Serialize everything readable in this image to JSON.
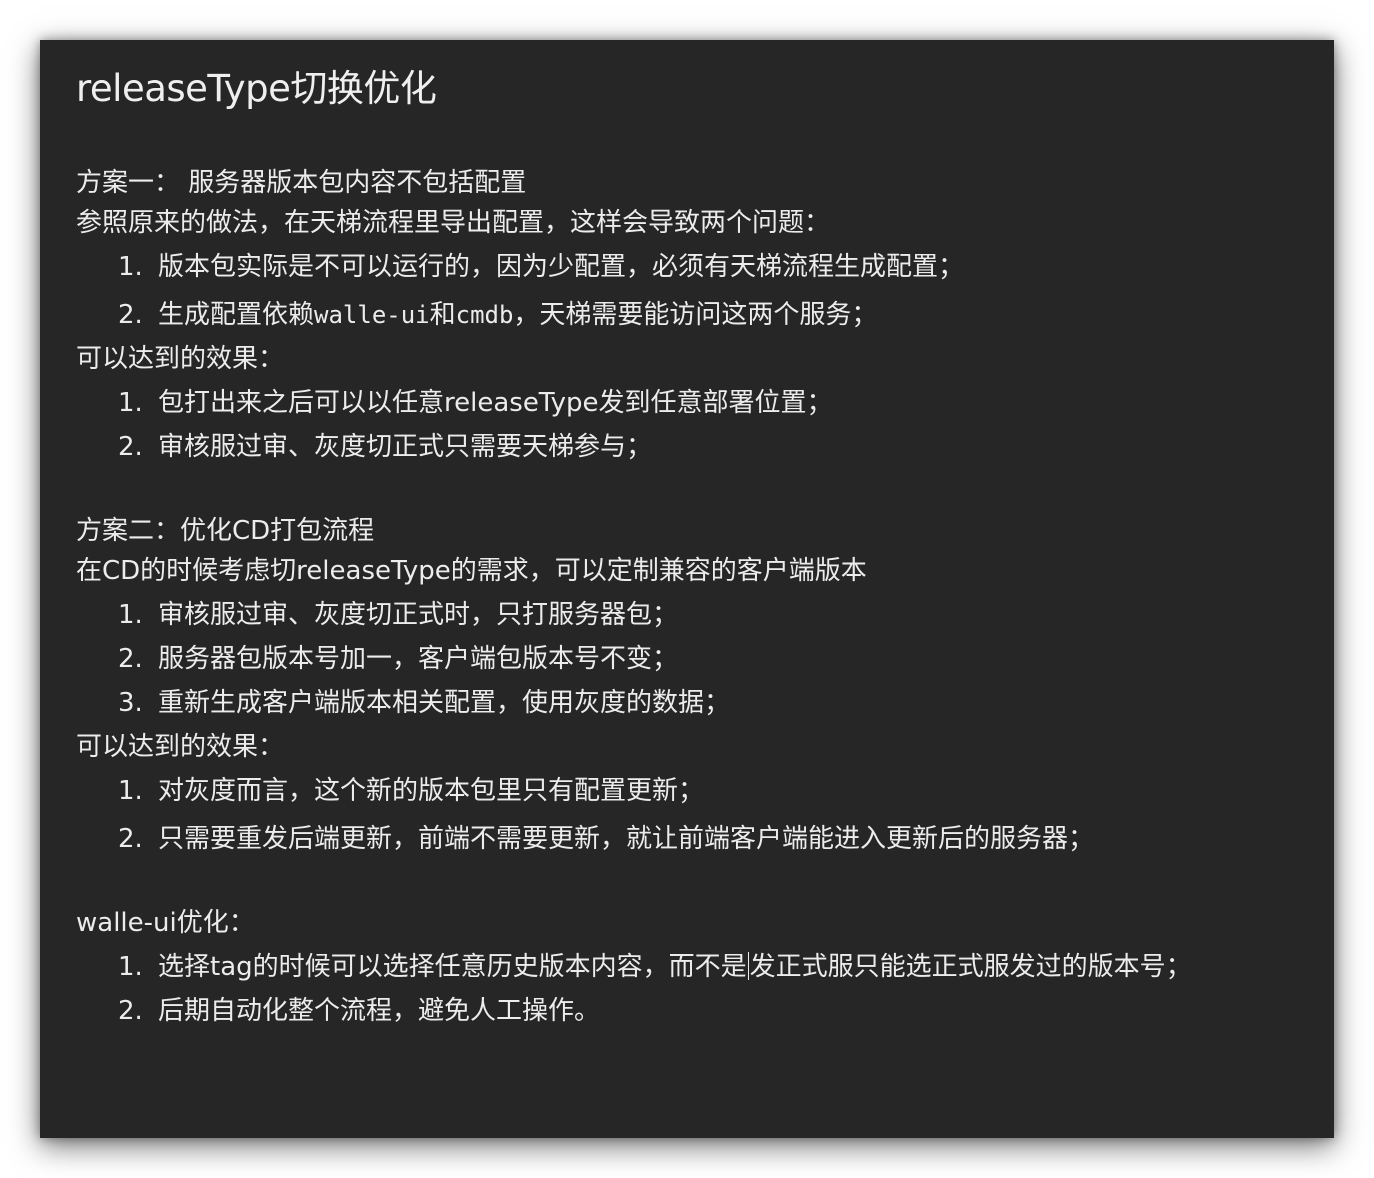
{
  "title": "releaseType切换优化",
  "plan1": {
    "heading": "方案一： 服务器版本包内容不包括配置",
    "intro": "参照原来的做法，在天梯流程里导出配置，这样会导致两个问题：",
    "problems": [
      {
        "num": "1.",
        "text": "版本包实际是不可以运行的，因为少配置，必须有天梯流程生成配置；"
      },
      {
        "num": "2.",
        "pre": "生成配置依赖",
        "code1": "walle-ui",
        "mid": "和",
        "code2": "cmdb",
        "post": "，天梯需要能访问这两个服务；"
      }
    ],
    "effect_label": "可以达到的效果：",
    "effects": [
      {
        "num": "1.",
        "text": "包打出来之后可以以任意releaseType发到任意部署位置；"
      },
      {
        "num": "2.",
        "text": "审核服过审、灰度切正式只需要天梯参与；"
      }
    ]
  },
  "plan2": {
    "heading": "方案二：优化CD打包流程",
    "intro": "在CD的时候考虑切releaseType的需求，可以定制兼容的客户端版本",
    "steps": [
      {
        "num": "1.",
        "text": "审核服过审、灰度切正式时，只打服务器包；"
      },
      {
        "num": "2.",
        "text": "服务器包版本号加一，客户端包版本号不变；"
      },
      {
        "num": "3.",
        "text": "重新生成客户端版本相关配置，使用灰度的数据；"
      }
    ],
    "effect_label": "可以达到的效果：",
    "effects": [
      {
        "num": "1.",
        "text": "对灰度而言，这个新的版本包里只有配置更新；"
      },
      {
        "num": "2.",
        "text": "只需要重发后端更新，前端不需要更新，就让前端客户端能进入更新后的服务器；"
      }
    ]
  },
  "walle": {
    "heading": "walle-ui优化：",
    "items": [
      {
        "num": "1.",
        "pre": "选择tag的时候可以选择任意历史版本内容，而不是",
        "post": "发正式服只能选正式服发过的版本号；"
      },
      {
        "num": "2.",
        "text": "后期自动化整个流程，避免人工操作。"
      }
    ]
  }
}
